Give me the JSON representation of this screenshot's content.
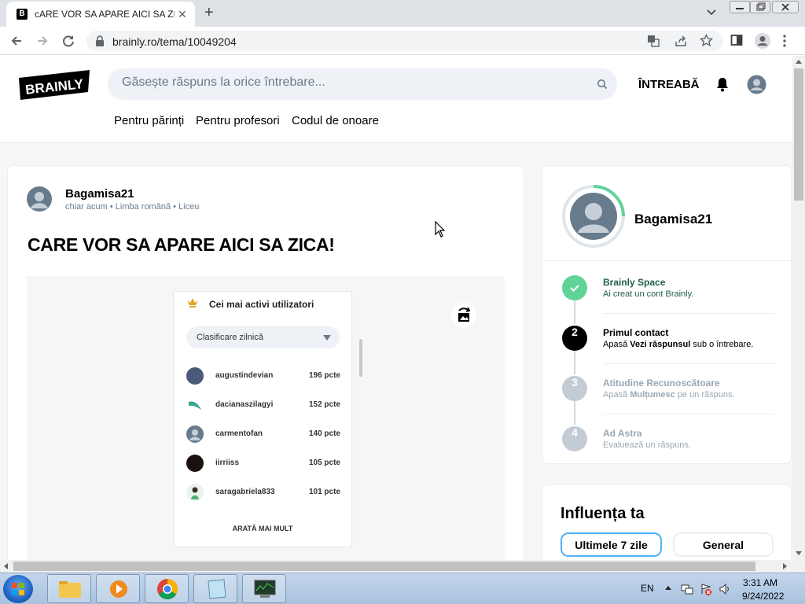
{
  "browser": {
    "tab_title": "cARE VOR SA APARE AICI SA ZIC",
    "tab_favicon": "B",
    "url": "brainly.ro/tema/10049204",
    "icons": [
      "back-icon",
      "forward-icon",
      "reload-icon",
      "lock-icon",
      "translate-icon",
      "share-icon",
      "star-icon",
      "sidepanel-icon",
      "profile-icon",
      "menu-icon"
    ]
  },
  "site": {
    "logo": "BRAINLY",
    "search_placeholder": "Găsește răspuns la orice întrebare...",
    "ask_label": "ÎNTREABĂ",
    "nav": [
      "Pentru părinți",
      "Pentru profesori",
      "Codul de onoare"
    ]
  },
  "question": {
    "author": "Bagamisa21",
    "meta": "chiar acum • Limba română • Liceu",
    "title": "CARE VOR SA APARE AICI SA ZICA!",
    "attachment": {
      "heading": "Cei mai activi utilizatori",
      "select_label": "Clasificare zilnică",
      "users": [
        {
          "name": "augustindevian",
          "points": "196 pcte"
        },
        {
          "name": "dacianaszilagyi",
          "points": "152 pcte"
        },
        {
          "name": "carmentofan",
          "points": "140 pcte"
        },
        {
          "name": "iirriiss",
          "points": "105 pcte"
        },
        {
          "name": "saragabriela833",
          "points": "101 pcte"
        }
      ],
      "show_more": "ARATĂ MAI MULT"
    }
  },
  "profile": {
    "name": "Bagamisa21",
    "steps": [
      {
        "num": "",
        "title": "Brainly Space",
        "desc": "Ai creat un cont Brainly.",
        "state": "done"
      },
      {
        "num": "2",
        "title": "Primul contact",
        "desc_pre": "Apasă ",
        "desc_bold": "Vezi răspunsul",
        "desc_post": " sub o întrebare.",
        "state": "current"
      },
      {
        "num": "3",
        "title": "Atitudine Recunoscătoare",
        "desc_pre": "Apasă ",
        "desc_bold": "Mulțumesc",
        "desc_post": " pe un răspuns.",
        "state": "locked"
      },
      {
        "num": "4",
        "title": "Ad Astra",
        "desc": "Evaluează un răspuns.",
        "state": "locked"
      }
    ]
  },
  "influence": {
    "title": "Influența ta",
    "tabs": [
      "Ultimele 7 zile",
      "General"
    ]
  },
  "taskbar": {
    "lang": "EN",
    "time": "3:31 AM",
    "date": "9/24/2022"
  },
  "colors": {
    "accent_green": "#60d399",
    "accent_blue": "#4fb3f6",
    "text_gray": "#687b8c"
  }
}
